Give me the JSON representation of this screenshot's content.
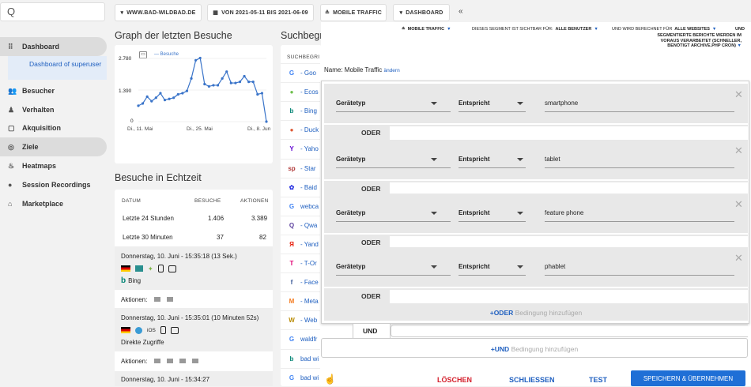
{
  "sidebar": {
    "search_glyph": "Q",
    "items": [
      {
        "label": "Dashboard",
        "icon": "grid-icon",
        "glyph": "⠿"
      },
      {
        "label": "Besucher",
        "icon": "users-icon",
        "glyph": "👥"
      },
      {
        "label": "Verhalten",
        "icon": "bell-icon",
        "glyph": "♟"
      },
      {
        "label": "Akquisition",
        "icon": "window-icon",
        "glyph": "▢"
      },
      {
        "label": "Ziele",
        "icon": "target-icon",
        "glyph": "◎"
      },
      {
        "label": "Heatmaps",
        "icon": "flame-icon",
        "glyph": "♨"
      },
      {
        "label": "Session Recordings",
        "icon": "record-icon",
        "glyph": "●"
      },
      {
        "label": "Marketplace",
        "icon": "marketplace-icon",
        "glyph": "⌂"
      }
    ],
    "sub_item": "Dashboard of superuser"
  },
  "topbar": {
    "site": "WWW.BAD-WILDBAD.DE",
    "date": "VON 2021-05-11 BIS 2021-06-09",
    "segment": "MOBILE TRAFFIC",
    "dashboard": "DASHBOARD"
  },
  "graph": {
    "title": "Graph der letzten Besuche",
    "legend": "Besuche",
    "yticks": [
      "2.780",
      "1.390",
      "0"
    ],
    "xticks": [
      "Di., 11. Mai",
      "Di., 25. Mai",
      "Di., 8. Jun"
    ]
  },
  "chart_data": {
    "type": "line",
    "series": [
      {
        "name": "Besuche",
        "values": [
          700,
          800,
          1100,
          900,
          1050,
          1250,
          950,
          1000,
          1050,
          1200,
          1250,
          1350,
          1900,
          2700,
          2800,
          1650,
          1550,
          1600,
          1600,
          1900,
          2200,
          1700,
          1700,
          1750,
          2000,
          1750,
          1750,
          1200,
          1250,
          0
        ]
      }
    ],
    "ylim": [
      0,
      2780
    ],
    "xticks": [
      "Di., 11. Mai",
      "Di., 25. Mai",
      "Di., 8. Jun"
    ],
    "color": "#3a74c9"
  },
  "realtime": {
    "title": "Besuche in Echtzeit",
    "headers": [
      "DATUM",
      "BESUCHE",
      "AKTIONEN"
    ],
    "rows": [
      {
        "label": "Letzte 24 Stunden",
        "visits": "1.406",
        "actions": "3.389"
      },
      {
        "label": "Letzte 30 Minuten",
        "visits": "37",
        "actions": "82"
      }
    ],
    "visits": [
      {
        "time": "Donnerstag, 10. Juni - 15:35:18 (13 Sek.)",
        "source": "Bing",
        "actions_label": "Aktionen:"
      },
      {
        "time": "Donnerstag, 10. Juni - 15:35:01 (10 Minuten 52s)",
        "os": "iOS",
        "source": "Direkte Zugriffe",
        "actions_label": "Aktionen:"
      },
      {
        "time": "Donnerstag, 10. Juni - 15:34:27"
      }
    ]
  },
  "search_engines": {
    "title": "Suchbegri",
    "header": "SUCHBEGRI",
    "items": [
      {
        "label": "- Goo",
        "glyph": "G",
        "color": "#4285f4"
      },
      {
        "label": "- Ecos",
        "glyph": "●",
        "color": "#6dbf4b"
      },
      {
        "label": "- Bing",
        "glyph": "b",
        "color": "#008373"
      },
      {
        "label": "- Duck",
        "glyph": "●",
        "color": "#de5833"
      },
      {
        "label": "- Yaho",
        "glyph": "Y",
        "color": "#6001d2"
      },
      {
        "label": "- Star",
        "glyph": "sp",
        "color": "#b13a3a"
      },
      {
        "label": "- Baid",
        "glyph": "✿",
        "color": "#2932e1"
      },
      {
        "label": "webca",
        "glyph": "G",
        "color": "#4285f4"
      },
      {
        "label": "- Qwa",
        "glyph": "Q",
        "color": "#5a3d9c"
      },
      {
        "label": "- Yand",
        "glyph": "Я",
        "color": "#e61400"
      },
      {
        "label": "- T-Or",
        "glyph": "T",
        "color": "#e20074"
      },
      {
        "label": "- Face",
        "glyph": "f",
        "color": "#3b5998"
      },
      {
        "label": "- Meta",
        "glyph": "M",
        "color": "#f47b20"
      },
      {
        "label": "- Web",
        "glyph": "W",
        "color": "#b88a00"
      },
      {
        "label": "waldfr",
        "glyph": "G",
        "color": "#4285f4"
      },
      {
        "label": "bad wi",
        "glyph": "b",
        "color": "#008373"
      },
      {
        "label": "bad wi",
        "glyph": "G",
        "color": "#4285f4"
      }
    ]
  },
  "segment_editor": {
    "segment_select": "MOBILE TRAFFIC",
    "visible_label": "DIESES SEGMENT IST SICHTBAR FÜR:",
    "visible_value": "ALLE BENUTZER",
    "processed_label": "UND WIRD BERECHNET FÜR",
    "processed_value": "ALLE WEBSITES",
    "und_cut": "UND",
    "preprocessed": "SEGMENTIERTE BERICHTE WERDEN IM VORAUS VERARBEITET (SCHNELLER, BENÖTIGT ARCHIVE.PHP CRON)",
    "name_label": "Name: Mobile Traffic",
    "change_link": "ändern",
    "conditions": [
      {
        "field": "Gerätetyp",
        "op": "Entspricht",
        "value": "smartphone"
      },
      {
        "field": "Gerätetyp",
        "op": "Entspricht",
        "value": "tablet"
      },
      {
        "field": "Gerätetyp",
        "op": "Entspricht",
        "value": "feature phone"
      },
      {
        "field": "Gerätetyp",
        "op": "Entspricht",
        "value": "phablet"
      }
    ],
    "or_label": "ODER",
    "add_or_prefix": "+ODER",
    "add_or_suffix": "Bedingung hinzufügen",
    "and_label": "UND",
    "add_and_prefix": "+UND",
    "add_and_suffix": "Bedingung hinzufügen",
    "delete": "LÖSCHEN",
    "close": "SCHLIESSEN",
    "test": "TEST",
    "save": "SPEICHERN & ÜBERNEHMEN"
  },
  "colors": {
    "accent": "#3a74c9",
    "link": "#2060c0",
    "delete": "#d4202c",
    "save_bg": "#1f6fd6"
  }
}
